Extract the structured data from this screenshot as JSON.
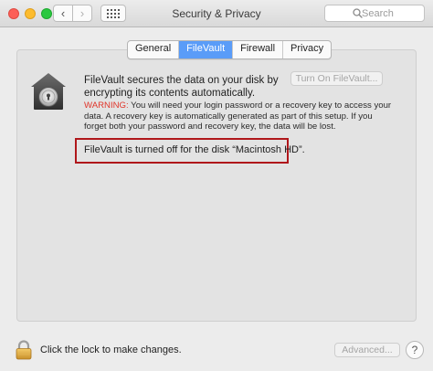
{
  "window": {
    "title": "Security & Privacy"
  },
  "toolbar": {
    "back_glyph": "‹",
    "forward_glyph": "›",
    "grid_icon": "grid-icon",
    "search_placeholder": "Search"
  },
  "tabs": [
    {
      "label": "General",
      "active": false
    },
    {
      "label": "FileVault",
      "active": true
    },
    {
      "label": "Firewall",
      "active": false
    },
    {
      "label": "Privacy",
      "active": false
    }
  ],
  "filevault": {
    "description": "FileVault secures the data on your disk by encrypting its contents automatically.",
    "turn_on_button": "Turn On FileVault...",
    "warning_label": "WARNING:",
    "warning_text": " You will need your login password or a recovery key to access your data. A recovery key is automatically generated as part of this setup. If you forget both your password and recovery key, the data will be lost.",
    "status": "FileVault is turned off for the disk “Macintosh HD”."
  },
  "footer": {
    "lock_text": "Click the lock to make changes.",
    "advanced_button": "Advanced...",
    "help_glyph": "?"
  },
  "colors": {
    "tab_active": "#5a9cf8",
    "warning_red": "#e0352a",
    "highlight_border": "#b0171b"
  }
}
